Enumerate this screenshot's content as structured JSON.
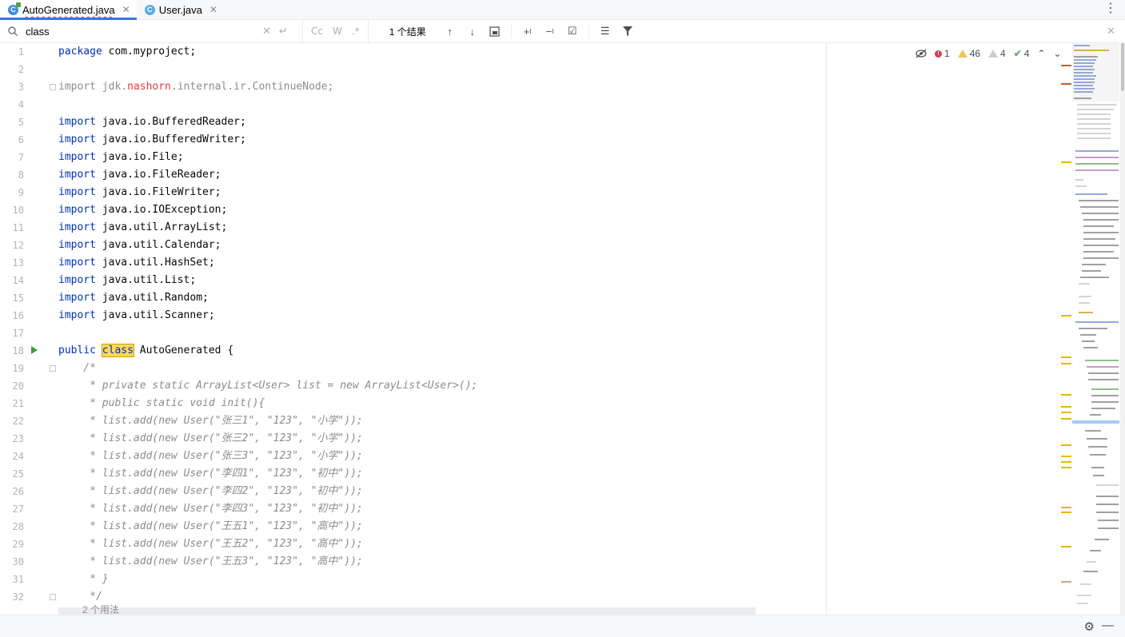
{
  "tabs": [
    {
      "label": "AutoGenerated.java",
      "icon": "java-class-icon",
      "active": true
    },
    {
      "label": "User.java",
      "icon": "java-class-icon",
      "active": false
    }
  ],
  "find": {
    "query": "class",
    "result": "1 个结果",
    "options": [
      "Cc",
      "W",
      ".*"
    ]
  },
  "inspections": {
    "errors": "1",
    "warnings": "46",
    "weak_warnings": "4",
    "typos": "4"
  },
  "line_numbers": [
    "1",
    "2",
    "3",
    "4",
    "5",
    "6",
    "7",
    "8",
    "9",
    "10",
    "11",
    "12",
    "13",
    "14",
    "15",
    "16",
    "17",
    "18",
    "19",
    "20",
    "21",
    "22",
    "23",
    "24",
    "25",
    "26",
    "27",
    "28",
    "29",
    "30",
    "31",
    "32"
  ],
  "code": {
    "l1_kw": "package",
    "l1_rest": " com.myproject;",
    "l3_a": "import jdk.",
    "l3_b": "nashorn",
    "l3_c": ".internal.ir.ContinueNode;",
    "imp": "import",
    "l5": " java.io.BufferedReader;",
    "l6": " java.io.BufferedWriter;",
    "l7": " java.io.File;",
    "l8": " java.io.FileReader;",
    "l9": " java.io.FileWriter;",
    "l10": " java.io.IOException;",
    "l11": " java.util.ArrayList;",
    "l12": " java.util.Calendar;",
    "l13": " java.util.HashSet;",
    "l14": " java.util.List;",
    "l15": " java.util.Random;",
    "l16": " java.util.Scanner;",
    "l18_kw": "public",
    "l18_class": "class",
    "l18_rest": " AutoGenerated {",
    "l19": "    /*",
    "l20": "     * private static ArrayList<User> list = new ArrayList<User>();",
    "l21": "     * public static void init(){",
    "l22": "     * list.add(new User(\"张三1\", \"123\", \"小学\"));",
    "l23": "     * list.add(new User(\"张三2\", \"123\", \"小学\"));",
    "l24": "     * list.add(new User(\"张三3\", \"123\", \"小学\"));",
    "l25": "     * list.add(new User(\"李四1\", \"123\", \"初中\"));",
    "l26": "     * list.add(new User(\"李四2\", \"123\", \"初中\"));",
    "l27": "     * list.add(new User(\"李四3\", \"123\", \"初中\"));",
    "l28": "     * list.add(new User(\"王五1\", \"123\", \"高中\"));",
    "l29": "     * list.add(new User(\"王五2\", \"123\", \"高中\"));",
    "l30": "     * list.add(new User(\"王五3\", \"123\", \"高中\"));",
    "l31": "     * }",
    "l32": "     */"
  },
  "usage_hint": "2 个用法",
  "colors": {
    "keyword": "#0033b3",
    "comment": "#8c8c8c",
    "highlight": "#fad75b",
    "error": "#db3b4b",
    "warning": "#f2c55c"
  }
}
